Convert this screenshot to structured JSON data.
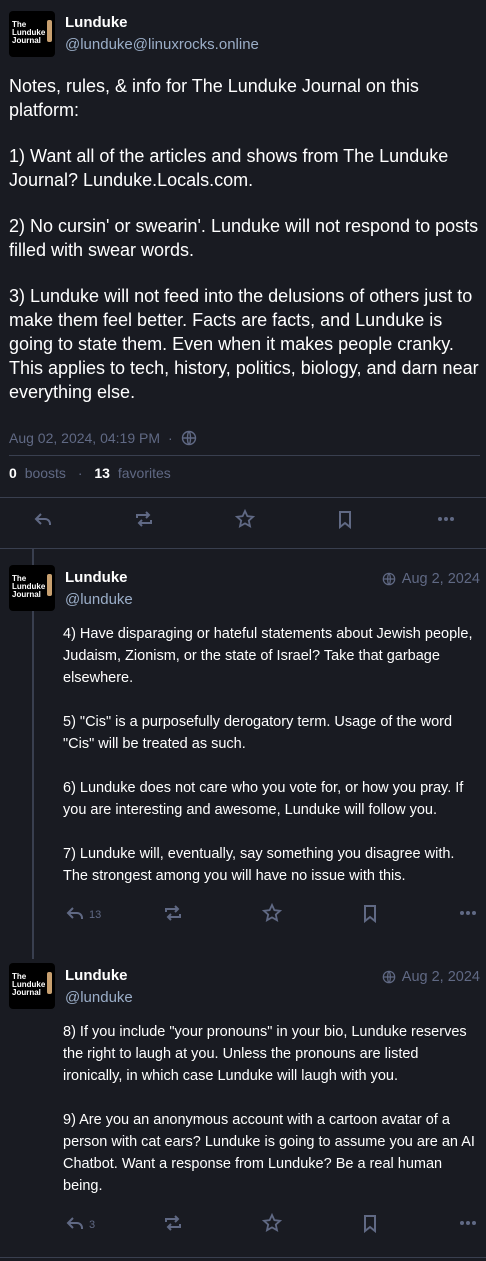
{
  "main": {
    "author_name": "Lunduke",
    "author_handle": "@lunduke@linuxrocks.online",
    "avatar_text": [
      "The",
      "Lunduke",
      "Journal"
    ],
    "paragraphs": [
      "Notes, rules, & info for The Lunduke Journal on this platform:",
      "1) Want all of the articles and shows from The Lunduke Journal?  Lunduke.Locals.com.",
      "2) No cursin' or swearin'.  Lunduke will not respond to posts filled with swear words.",
      "3) Lunduke will not feed into the delusions of others just to make them feel better.  Facts are facts, and Lunduke is going to state them.  Even when it makes people cranky.  This applies to tech, history, politics, biology, and darn near everything else."
    ],
    "timestamp": "Aug 02, 2024, 04:19 PM",
    "separator": "·",
    "boosts_count": "0",
    "boosts_label": "boosts",
    "favorites_count": "13",
    "favorites_label": "favorites"
  },
  "replies": [
    {
      "author_name": "Lunduke",
      "author_handle": "@lunduke",
      "date": "Aug 2, 2024",
      "paragraphs": [
        "4) Have disparaging or hateful statements about Jewish people, Judaism, Zionism, or the state of Israel?  Take that garbage elsewhere.",
        "5) \"Cis\" is a purposefully derogatory term.  Usage of the word \"Cis\" will be treated as such.",
        "6) Lunduke does not care who you vote for, or how you pray.  If you are interesting and awesome, Lunduke will follow you.",
        "7) Lunduke will, eventually, say something you disagree with.  The strongest among you will have no issue with this."
      ],
      "reply_count": "13"
    },
    {
      "author_name": "Lunduke",
      "author_handle": "@lunduke",
      "date": "Aug 2, 2024",
      "paragraphs": [
        "8) If you include \"your pronouns\" in your bio, Lunduke reserves the right to laugh at you.  Unless the pronouns are listed ironically, in which case Lunduke will laugh with you.",
        "9) Are you an anonymous account with a cartoon avatar of a person with cat ears?  Lunduke is going to assume you are an AI Chatbot.  Want a response from Lunduke?  Be a real human being."
      ],
      "reply_count": "3"
    }
  ],
  "icons": {
    "reply": "reply-icon",
    "boost": "boost-icon",
    "favorite": "star-icon",
    "bookmark": "bookmark-icon",
    "more": "more-icon",
    "visibility": "globe-icon"
  },
  "colors": {
    "background": "#191b22",
    "muted": "#606984",
    "handle": "#9baec8",
    "divider": "#393f4f"
  }
}
